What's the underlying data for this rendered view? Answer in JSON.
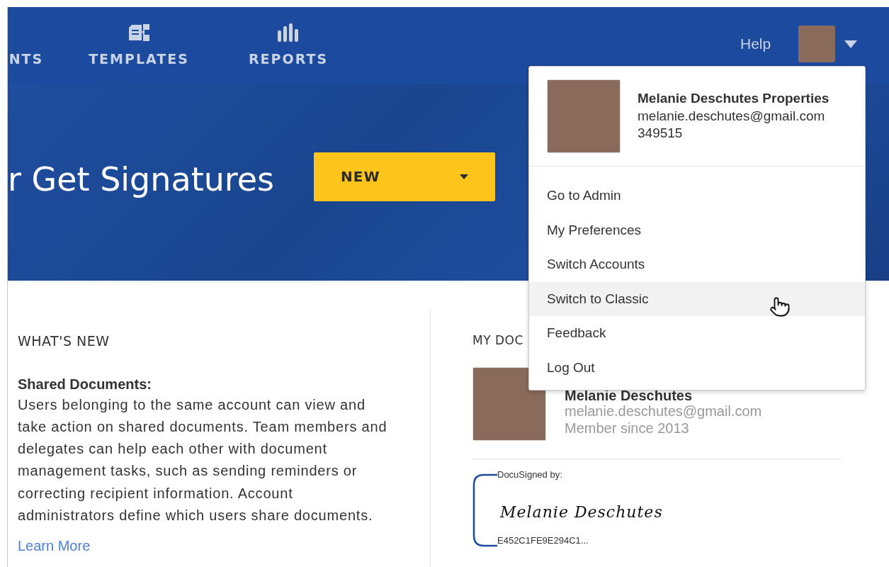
{
  "nav": {
    "items": [
      {
        "label": "NTS",
        "kind": "plain"
      },
      {
        "label": "TEMPLATES",
        "kind": "templates"
      },
      {
        "label": "REPORTS",
        "kind": "reports"
      }
    ],
    "help": "Help"
  },
  "hero": {
    "title": "r Get Signatures",
    "new_button": "NEW"
  },
  "whats_new": {
    "heading": "WHAT'S NEW",
    "subheading": "Shared Documents:",
    "body": "Users belonging to the same account can view and take action on shared documents. Team members and delegates can help each other with document management tasks, such as sending reminders or correcting recipient information. Account administrators define which users share documents.",
    "link": "Learn More"
  },
  "my_documents": {
    "heading": "MY DOC",
    "name": "Melanie Deschutes",
    "email": "melanie.deschutes@gmail.com",
    "member_since": "Member since 2013",
    "signature": {
      "label": "DocuSigned by:",
      "signed_name": "Melanie Deschutes",
      "hash": "E452C1FE9E294C1..."
    }
  },
  "account_menu": {
    "name": "Melanie Deschutes Properties",
    "email": "melanie.deschutes@gmail.com",
    "account_id": "349515",
    "items": [
      {
        "label": "Go to Admin",
        "hovered": false
      },
      {
        "label": "My Preferences",
        "hovered": false
      },
      {
        "label": "Switch Accounts",
        "hovered": false
      },
      {
        "label": "Switch to Classic",
        "hovered": true
      },
      {
        "label": "Feedback",
        "hovered": false
      },
      {
        "label": "Log Out",
        "hovered": false
      }
    ]
  }
}
